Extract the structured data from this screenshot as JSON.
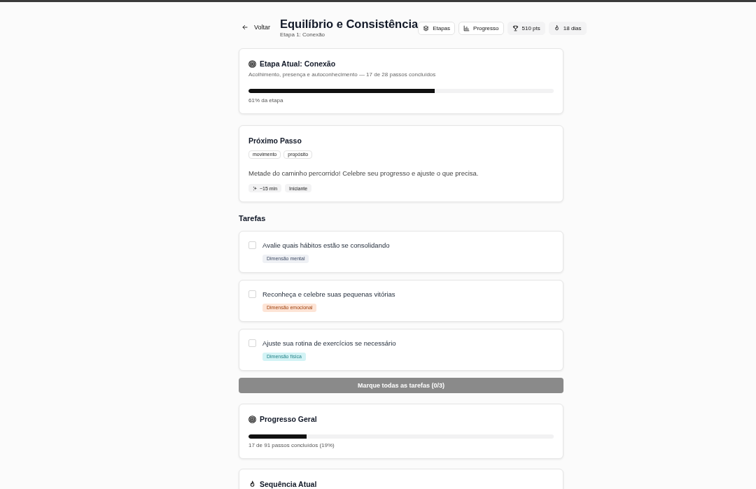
{
  "header": {
    "back": "Voltar",
    "title": "Equilíbrio e Consistência",
    "subtitle": "Etapa 1: Conexão",
    "actions": [
      {
        "label": "Etapas",
        "kind": "button"
      },
      {
        "label": "Progresso",
        "kind": "button"
      },
      {
        "label": "510 pts",
        "kind": "stat"
      },
      {
        "label": "18 dias",
        "kind": "stat"
      }
    ]
  },
  "current_stage": {
    "title": "Etapa Atual: Conexão",
    "description": "Acolhimento, presença e autoconhecimento — 17 de 28 passos concluídos",
    "level": 0.61,
    "caption": "61% da etapa"
  },
  "next_step": {
    "title": "Próximo Passo",
    "tags": [
      "movimento",
      "propósito"
    ],
    "text": "Metade do caminho percorrido! Celebre seu progresso e ajuste o que precisa.",
    "meta": [
      "~15 min",
      "Iniciante"
    ]
  },
  "tasks": {
    "heading": "Tarefas",
    "items": [
      {
        "label": "Avalie quais hábitos estão se consolidando",
        "checked": false,
        "tag": "Dimensão mental",
        "color": "#eff1f5"
      },
      {
        "label": "Reconheça e celebre suas pequenas vitórias",
        "checked": false,
        "tag": "Dimensão emocional",
        "color": "#fde4d6"
      },
      {
        "label": "Ajuste sua rotina de exercícios se necessário",
        "checked": false,
        "tag": "Dimensão física",
        "color": "#d3f3f5"
      }
    ],
    "button": {
      "label": "Marque todas as tarefas (0/3)",
      "disabled": true
    }
  },
  "overall_progress": {
    "title": "Progresso Geral",
    "level": 0.19,
    "caption": "17 de 91 passos concluídos (19%)"
  },
  "streak": {
    "title": "Sequência Atual"
  }
}
